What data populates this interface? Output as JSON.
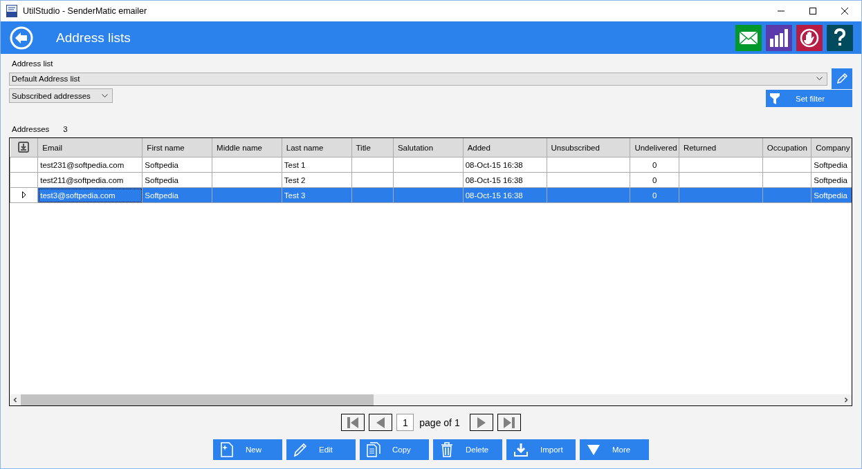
{
  "window": {
    "title": "UtilStudio - SenderMatic emailer"
  },
  "header": {
    "title": "Address lists"
  },
  "address_list": {
    "label": "Address list",
    "value": "Default Address list"
  },
  "status_filter": {
    "value": "Subscribed addresses"
  },
  "filter_button": "Set filter",
  "count": {
    "label": "Addresses",
    "value": "3"
  },
  "table": {
    "columns": [
      "Email",
      "First name",
      "Middle name",
      "Last name",
      "Title",
      "Salutation",
      "Added",
      "Unsubscribed",
      "Undelivered",
      "Returned",
      "Occupation",
      "Company"
    ],
    "rows": [
      {
        "selected": false,
        "cells": [
          "test231@softpedia.com",
          "Softpedia",
          "",
          "Test 1",
          "",
          "",
          "08-Oct-15 16:38",
          "",
          "0",
          "",
          "",
          "Softpedia"
        ]
      },
      {
        "selected": false,
        "cells": [
          "test211@softpedia.com",
          "Softpedia",
          "",
          "Test 2",
          "",
          "",
          "08-Oct-15 16:38",
          "",
          "0",
          "",
          "",
          "Softpedia"
        ]
      },
      {
        "selected": true,
        "cells": [
          "test3@softpedia.com",
          "Softpedia",
          "",
          "Test 3",
          "",
          "",
          "08-Oct-15 16:38",
          "",
          "0",
          "",
          "",
          "Softpedia"
        ]
      }
    ]
  },
  "pager": {
    "page": "1",
    "label": "page of 1"
  },
  "actions": [
    {
      "kind": "new",
      "label": "New"
    },
    {
      "kind": "edit",
      "label": "Edit"
    },
    {
      "kind": "copy",
      "label": "Copy"
    },
    {
      "kind": "delete",
      "label": "Delete"
    },
    {
      "kind": "import",
      "label": "Import"
    },
    {
      "kind": "more",
      "label": "More"
    }
  ]
}
